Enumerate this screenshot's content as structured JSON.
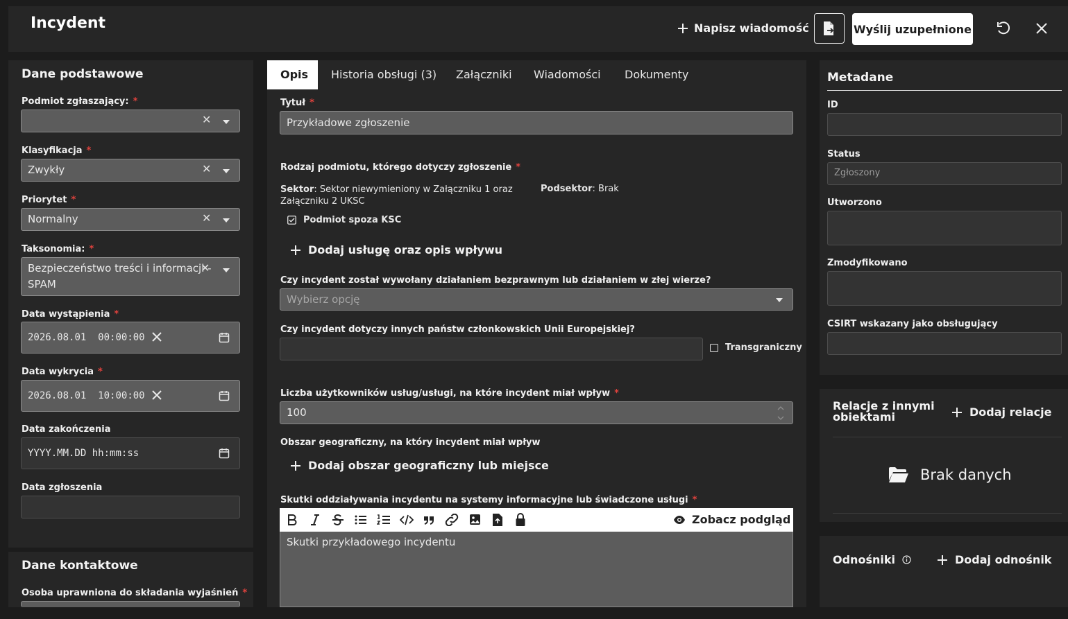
{
  "header": {
    "title": "Incydent",
    "compose_label": "Napisz wiadomość",
    "send_label": "Wyślij uzupełnione"
  },
  "left": {
    "basic_title": "Dane podstawowe",
    "fields": {
      "reporter": {
        "label": "Podmiot zgłaszający:",
        "value": ""
      },
      "classification": {
        "label": "Klasyfikacja",
        "value": "Zwykły"
      },
      "priority": {
        "label": "Priorytet",
        "value": "Normalny"
      },
      "taxonomy": {
        "label": "Taksonomia:",
        "value_line1": "Bezpieczeństwo treści i informacji -",
        "value_line2": "SPAM"
      },
      "occurrence": {
        "label": "Data wystąpienia",
        "year": "2026",
        "month": "08",
        "day": "01",
        "time": "00:00:00"
      },
      "detection": {
        "label": "Data wykrycia",
        "year": "2026",
        "month": "08",
        "day": "01",
        "time": "10:00:00"
      },
      "end": {
        "label": "Data zakończenia",
        "placeholder_date": "YYYY.MM.DD",
        "placeholder_h": "hh",
        "placeholder_m": "mm",
        "placeholder_s": "ss"
      },
      "report": {
        "label": "Data zgłoszenia",
        "value": ""
      }
    },
    "contact_title": "Dane kontaktowe",
    "contact_person_label": "Osoba uprawniona do składania wyjaśnień"
  },
  "tabs": [
    {
      "label": "Opis"
    },
    {
      "label": "Historia obsługi (3)"
    },
    {
      "label": "Załączniki"
    },
    {
      "label": "Wiadomości"
    },
    {
      "label": "Dokumenty"
    }
  ],
  "main": {
    "title_label": "Tytuł",
    "title_value": "Przykładowe zgłoszenie",
    "entity_type_label": "Rodzaj podmiotu, którego dotyczy zgłoszenie",
    "sector_key": "Sektor",
    "sector_value_line1": "Sektor niewymieniony w Załączniku 1 oraz",
    "sector_value_line2": "Załączniku 2 UKSC",
    "subsector_key": "Podsektor",
    "subsector_value": "Brak",
    "outside_ksc_label": "Podmiot spoza KSC",
    "add_service_label": "Dodaj usługę oraz opis wpływu",
    "unlawful_label": "Czy incydent został wywołany działaniem bezprawnym lub działaniem w złej wierze?",
    "unlawful_placeholder": "Wybierz opcję",
    "eu_label": "Czy incydent dotyczy innych państw członkowskich Unii Europejskiej?",
    "eu_value": "",
    "crossborder_label": "Transgraniczny",
    "users_label": "Liczba użytkowników usług/usługi, na które incydent miał wpływ",
    "users_value": "100",
    "geo_label": "Obszar geograficzny, na który incydent miał wpływ",
    "add_geo_label": "Dodaj obszar geograficzny lub miejsce",
    "effects_label": "Skutki oddziaływania incydentu na systemy informacyjne lub świadczone usługi",
    "preview_label": "Zobacz podgląd",
    "effects_value": "Skutki przykładowego incydentu"
  },
  "right": {
    "meta_title": "Metadane",
    "id_label": "ID",
    "id_value": "",
    "status_label": "Status",
    "status_value": "Zgłoszony",
    "created_label": "Utworzono",
    "created_value": "",
    "modified_label": "Zmodyfikowano",
    "modified_value": "",
    "csirt_label": "CSIRT wskazany jako obsługujący",
    "csirt_value": "",
    "relations_title_line1": "Relacje z innymi",
    "relations_title_line2": "obiektami",
    "add_relation_label": "Dodaj relacje",
    "no_data_label": "Brak danych",
    "links_title": "Odnośniki",
    "add_link_label": "Dodaj odnośnik"
  },
  "icons": {
    "plus": "plus-icon",
    "file-export": "file-export-icon",
    "undo": "undo-icon",
    "close": "close-icon",
    "calendar": "calendar-icon",
    "folder": "folder-open-icon",
    "info": "info-icon",
    "eye": "eye-icon"
  },
  "colors": {
    "background": "#1c1c1c",
    "panel": "#262626",
    "field": "#5c5c5c",
    "required": "#e0423d",
    "accent_button": "#ffffff"
  }
}
